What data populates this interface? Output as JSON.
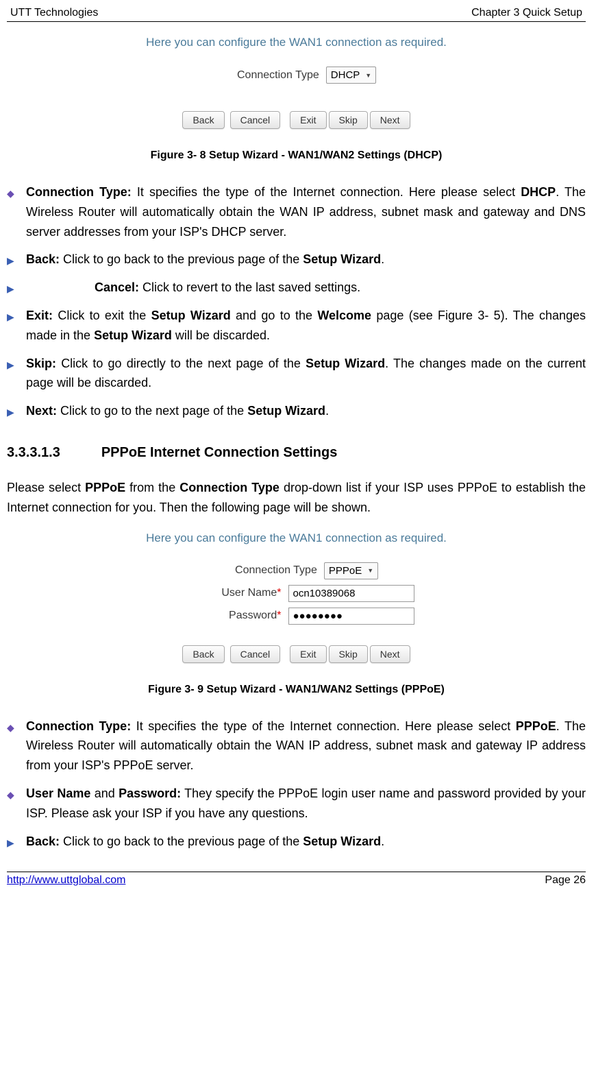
{
  "header": {
    "left": "UTT Technologies",
    "right": "Chapter 3 Quick Setup"
  },
  "panel1": {
    "help": "Here you can configure the WAN1 connection as required.",
    "conn_label": "Connection Type",
    "conn_value": "DHCP",
    "buttons": {
      "back": "Back",
      "cancel": "Cancel",
      "exit": "Exit",
      "skip": "Skip",
      "next": "Next"
    }
  },
  "fig1": "Figure 3- 8 Setup Wizard - WAN1/WAN2 Settings (DHCP)",
  "items1": {
    "conn_type_label": "Connection Type:",
    "conn_type_text": " It specifies the type of the Internet connection. Here please select ",
    "conn_type_bold": "DHCP",
    "conn_type_text2": ". The Wireless Router will automatically obtain the WAN IP address, subnet mask and gateway and DNS server addresses from your ISP's DHCP server.",
    "back_label": "Back:",
    "back_text": " Click to go back to the previous page of the ",
    "back_bold": "Setup Wizard",
    "cancel_label": "Cancel:",
    "cancel_text": " Click to revert to the last saved settings.",
    "exit_label": "Exit:",
    "exit_text": " Click to exit the ",
    "exit_bold1": "Setup Wizard",
    "exit_text2": " and go to the ",
    "exit_bold2": "Welcome",
    "exit_text3": " page (see Figure 3- 5). The changes made in the ",
    "exit_bold3": "Setup Wizard",
    "exit_text4": " will be discarded.",
    "skip_label": "Skip:",
    "skip_text": " Click to go directly to the next page of the ",
    "skip_bold": "Setup Wizard",
    "skip_text2": ". The changes made on the current page will be discarded.",
    "next_label": "Next:",
    "next_text": " Click to go to the next page of the ",
    "next_bold": "Setup Wizard"
  },
  "section": {
    "num": "3.3.3.1.3",
    "title": "PPPoE Internet Connection Settings"
  },
  "para": {
    "t1": "Please select ",
    "b1": "PPPoE",
    "t2": " from the ",
    "b2": "Connection Type",
    "t3": " drop-down list if your ISP uses PPPoE to establish the Internet connection for you. Then the following page will be shown."
  },
  "panel2": {
    "help": "Here you can configure the WAN1 connection as required.",
    "conn_label": "Connection Type",
    "conn_value": "PPPoE",
    "user_label": "User Name",
    "user_value": "ocn10389068",
    "pass_label": "Password",
    "pass_value": "●●●●●●●●",
    "buttons": {
      "back": "Back",
      "cancel": "Cancel",
      "exit": "Exit",
      "skip": "Skip",
      "next": "Next"
    }
  },
  "fig2": "Figure 3- 9 Setup Wizard - WAN1/WAN2 Settings (PPPoE)",
  "items2": {
    "conn_type_label": "Connection Type:",
    "conn_type_text": " It specifies the type of the Internet connection. Here please select ",
    "conn_type_bold": "PPPoE",
    "conn_type_text2": ". The Wireless Router will automatically obtain the WAN IP address, subnet mask and gateway IP address from your ISP's PPPoE server.",
    "user_label": "User Name",
    "pass_label": "Password:",
    "user_text": " They specify the PPPoE login user name and password provided by your ISP. Please ask your ISP if you have any questions.",
    "back_label": "Back:",
    "back_text": " Click to go back to the previous page of the ",
    "back_bold": "Setup Wizard"
  },
  "footer": {
    "link": "http://www.uttglobal.com",
    "page": "Page 26"
  }
}
